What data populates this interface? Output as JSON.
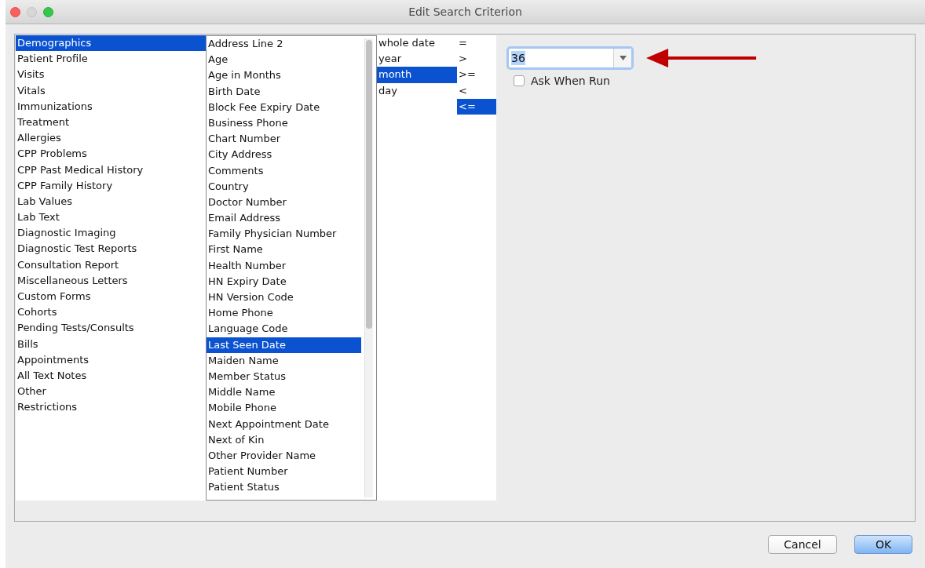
{
  "window": {
    "title": "Edit Search Criterion"
  },
  "categories": [
    {
      "label": "Demographics",
      "selected": true
    },
    {
      "label": "Patient Profile",
      "selected": false
    },
    {
      "label": "Visits",
      "selected": false
    },
    {
      "label": "Vitals",
      "selected": false
    },
    {
      "label": "Immunizations",
      "selected": false
    },
    {
      "label": "Treatment",
      "selected": false
    },
    {
      "label": "Allergies",
      "selected": false
    },
    {
      "label": "CPP Problems",
      "selected": false
    },
    {
      "label": "CPP Past Medical History",
      "selected": false
    },
    {
      "label": "CPP Family History",
      "selected": false
    },
    {
      "label": "Lab Values",
      "selected": false
    },
    {
      "label": "Lab Text",
      "selected": false
    },
    {
      "label": "Diagnostic Imaging",
      "selected": false
    },
    {
      "label": "Diagnostic Test Reports",
      "selected": false
    },
    {
      "label": "Consultation Report",
      "selected": false
    },
    {
      "label": "Miscellaneous Letters",
      "selected": false
    },
    {
      "label": "Custom Forms",
      "selected": false
    },
    {
      "label": "Cohorts",
      "selected": false
    },
    {
      "label": "Pending Tests/Consults",
      "selected": false
    },
    {
      "label": "Bills",
      "selected": false
    },
    {
      "label": "Appointments",
      "selected": false
    },
    {
      "label": "All Text Notes",
      "selected": false
    },
    {
      "label": "Other",
      "selected": false
    },
    {
      "label": "Restrictions",
      "selected": false
    }
  ],
  "fields": [
    {
      "label": "Address Line 2",
      "selected": false
    },
    {
      "label": "Age",
      "selected": false
    },
    {
      "label": "Age in Months",
      "selected": false
    },
    {
      "label": "Birth Date",
      "selected": false
    },
    {
      "label": "Block Fee Expiry Date",
      "selected": false
    },
    {
      "label": "Business Phone",
      "selected": false
    },
    {
      "label": "Chart Number",
      "selected": false
    },
    {
      "label": "City Address",
      "selected": false
    },
    {
      "label": "Comments",
      "selected": false
    },
    {
      "label": "Country",
      "selected": false
    },
    {
      "label": "Doctor Number",
      "selected": false
    },
    {
      "label": "Email Address",
      "selected": false
    },
    {
      "label": "Family Physician Number",
      "selected": false
    },
    {
      "label": "First Name",
      "selected": false
    },
    {
      "label": "Health Number",
      "selected": false
    },
    {
      "label": "HN Expiry Date",
      "selected": false
    },
    {
      "label": "HN Version Code",
      "selected": false
    },
    {
      "label": "Home Phone",
      "selected": false
    },
    {
      "label": "Language Code",
      "selected": false
    },
    {
      "label": "Last Seen Date",
      "selected": true
    },
    {
      "label": "Maiden Name",
      "selected": false
    },
    {
      "label": "Member Status",
      "selected": false
    },
    {
      "label": "Middle Name",
      "selected": false
    },
    {
      "label": "Mobile Phone",
      "selected": false
    },
    {
      "label": "Next Appointment Date",
      "selected": false
    },
    {
      "label": "Next of Kin",
      "selected": false
    },
    {
      "label": "Other Provider Name",
      "selected": false
    },
    {
      "label": "Patient Number",
      "selected": false
    },
    {
      "label": "Patient Status",
      "selected": false
    }
  ],
  "units": [
    {
      "label": "whole date",
      "selected": false
    },
    {
      "label": "year",
      "selected": false
    },
    {
      "label": "month",
      "selected": true
    },
    {
      "label": "day",
      "selected": false
    }
  ],
  "operators": [
    {
      "label": "=",
      "selected": false
    },
    {
      "label": ">",
      "selected": false
    },
    {
      "label": ">=",
      "selected": false
    },
    {
      "label": "<",
      "selected": false
    },
    {
      "label": "<=",
      "selected": true
    }
  ],
  "value_field": {
    "value": "36"
  },
  "ask_when_run": {
    "label": "Ask When Run",
    "checked": false
  },
  "buttons": [
    {
      "label": "Cancel",
      "kind": "normal"
    },
    {
      "label": "OK",
      "kind": "default"
    }
  ]
}
